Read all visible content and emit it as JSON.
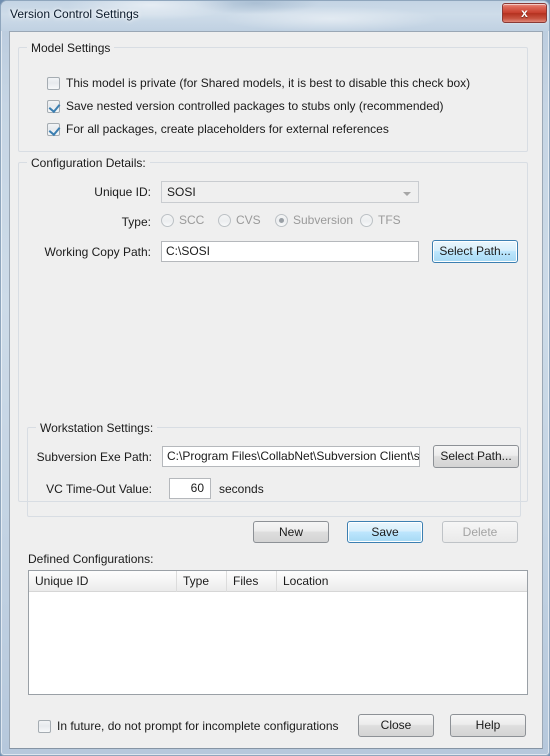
{
  "window": {
    "title": "Version Control Settings",
    "close_label": "x",
    "close_icon": "close-icon"
  },
  "model_settings": {
    "legend": "Model Settings",
    "checkboxes": [
      {
        "label": "This model is private (for Shared models, it is best to disable this check box)",
        "checked": false
      },
      {
        "label": "Save nested version controlled packages to stubs only (recommended)",
        "checked": true
      },
      {
        "label": "For all packages, create placeholders for external references",
        "checked": true
      }
    ]
  },
  "configuration_details": {
    "legend": "Configuration Details:",
    "unique_id": {
      "label": "Unique ID:",
      "value": "SOSI",
      "enabled": false
    },
    "type": {
      "label": "Type:",
      "options": [
        "SCC",
        "CVS",
        "Subversion",
        "TFS"
      ],
      "selected": "Subversion",
      "enabled": false
    },
    "working_copy_path": {
      "label": "Working Copy Path:",
      "value": "C:\\SOSI",
      "button_label": "Select Path..."
    }
  },
  "workstation_settings": {
    "legend": "Workstation Settings:",
    "exe_path": {
      "label": "Subversion Exe Path:",
      "value": "C:\\Program Files\\CollabNet\\Subversion Client\\svn.exe",
      "button_label": "Select Path..."
    },
    "timeout": {
      "label": "VC Time-Out Value:",
      "value": "60",
      "units": "seconds"
    }
  },
  "action_buttons": {
    "new_label": "New",
    "save_label": "Save",
    "delete_label": "Delete",
    "delete_enabled": false,
    "save_is_default": true
  },
  "defined_configurations": {
    "legend": "Defined Configurations:",
    "columns": [
      "Unique ID",
      "Type",
      "Files",
      "Location"
    ],
    "rows": []
  },
  "footer": {
    "checkbox": {
      "label": "In future, do not prompt for incomplete configurations",
      "checked": false
    },
    "close_label": "Close",
    "help_label": "Help"
  },
  "colors": {
    "accent": "#3c7fb1",
    "close_red": "#c63d2c",
    "client_bg": "#efefef",
    "frame_blue": "#c6d5e4"
  }
}
